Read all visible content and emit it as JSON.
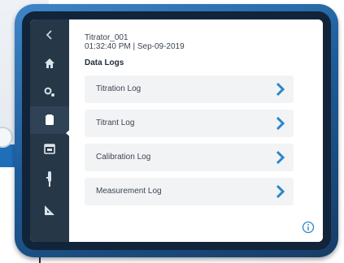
{
  "header": {
    "device_name": "Titrator_001",
    "timestamp": "01:32:40 PM | Sep-09-2019"
  },
  "section": {
    "title": "Data Logs"
  },
  "logs": [
    {
      "label": "Titration Log"
    },
    {
      "label": "Titrant Log"
    },
    {
      "label": "Calibration Log"
    },
    {
      "label": "Measurement Log"
    }
  ],
  "nav": {
    "items": [
      "back-icon",
      "home-icon",
      "settings-icon",
      "data-logs-icon",
      "calendar-icon",
      "probe-icon",
      "ruler-icon"
    ],
    "active": "data-logs-icon"
  },
  "colors": {
    "frame": "#2a6fb0",
    "nav_background": "#263747",
    "chevron": "#2a86c9",
    "row_background": "#f2f3f5"
  }
}
